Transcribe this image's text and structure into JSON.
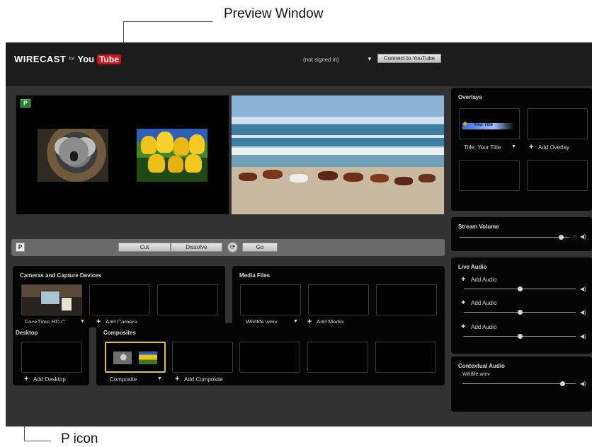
{
  "annotations": {
    "preview_window": "Preview Window",
    "p_icon": "P icon"
  },
  "header": {
    "brand": "WIRECAST",
    "brand_for": "for",
    "brand_you": "You",
    "brand_tube": "Tube",
    "account": "(not signed in)",
    "connect_button": "Connect to YouTube"
  },
  "preview": {
    "badge": "P"
  },
  "transition": {
    "badge": "P",
    "cut": "Cut",
    "dissolve": "Dissolve",
    "go": "Go"
  },
  "cameras": {
    "title": "Cameras and Capture Devices",
    "selected": "FaceTime HD C...",
    "add": "Add Camera"
  },
  "media": {
    "title": "Media Files",
    "selected": "Wildlife.wmv",
    "add": "Add Media"
  },
  "desktop": {
    "title": "Desktop",
    "add": "Add Desktop"
  },
  "composites": {
    "title": "Composites",
    "selected": "Composite",
    "add": "Add Composite"
  },
  "overlays": {
    "title": "Overlays",
    "title_slot_text": "Your Title",
    "selected": "Title:  Your Title",
    "add": "Add Overlay"
  },
  "stream_volume": {
    "title": "Stream Volume",
    "level": 0.92
  },
  "live_audio": {
    "title": "Live Audio",
    "items": [
      {
        "label": "Add Audio",
        "level": 0.5
      },
      {
        "label": "Add Audio",
        "level": 0.5
      },
      {
        "label": "Add Audio",
        "level": 0.5
      }
    ]
  },
  "contextual_audio": {
    "title": "Contextual Audio",
    "source": "Wildlife.wmv",
    "level": 0.88
  },
  "colors": {
    "app_bg": "#323232",
    "panel_bg": "#050505",
    "preview_badge": "#1f7a2a",
    "composite_highlight": "#d9c431",
    "youtube_red": "#cc181e"
  }
}
